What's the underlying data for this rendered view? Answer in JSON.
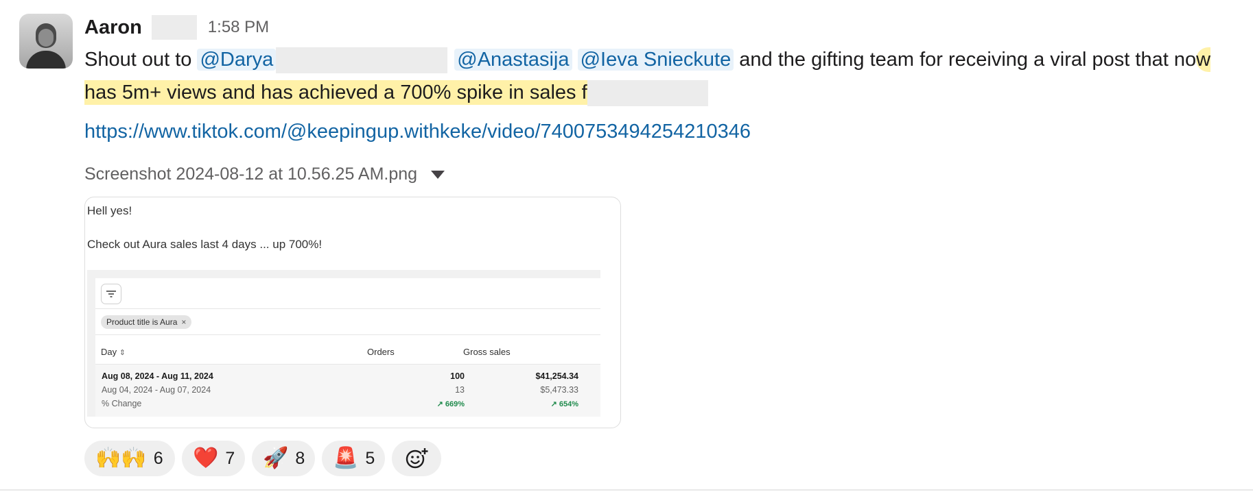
{
  "message": {
    "author": "Aaron",
    "time": "1:58 PM",
    "text_prefix": "Shout out to ",
    "mentions": [
      "@Darya",
      "@Anastasija",
      "@Ieva Snieckute"
    ],
    "text_mid": " and the gifting team for receiving a viral post that no",
    "text_highlight": "w has 5m+ views and has achieved a 700% spike in sales f",
    "link": "https://www.tiktok.com/@keepingup.withkeke/video/7400753494254210346"
  },
  "attachment": {
    "filename": "Screenshot 2024-08-12 at 10.56.25 AM.png",
    "line1": "Hell yes!",
    "line2": "Check out Aura sales last 4 days ... up 700%!",
    "filter_chip": "Product title is Aura",
    "filter_chip_close": "×",
    "headers": {
      "day": "Day",
      "day_sort": "⇕",
      "orders": "Orders",
      "gross": "Gross sales"
    },
    "rows": [
      {
        "day": "Aug 08, 2024 - Aug 11, 2024",
        "orders": "100",
        "gross": "$41,254.34"
      },
      {
        "day": "Aug 04, 2024 - Aug 07, 2024",
        "orders": "13",
        "gross": "$5,473.33"
      },
      {
        "day": "% Change",
        "orders": "↗ 669%",
        "gross": "↗ 654%"
      }
    ]
  },
  "reactions": [
    {
      "icon": "raised-hands-icon",
      "emoji": "🙌🙌",
      "count": "6"
    },
    {
      "icon": "heart-icon",
      "emoji": "❤️",
      "count": "7"
    },
    {
      "icon": "rocket-icon",
      "emoji": "🚀",
      "count": "8"
    },
    {
      "icon": "siren-icon",
      "emoji": "🚨",
      "count": "5"
    }
  ],
  "add_reaction_icon": "add-reaction-icon"
}
